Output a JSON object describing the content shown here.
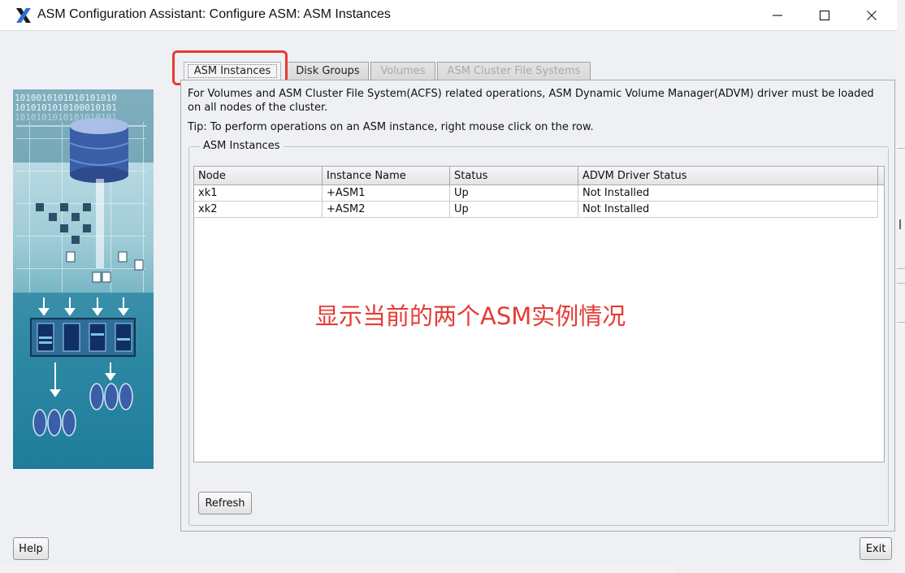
{
  "window": {
    "title": "ASM Configuration Assistant: Configure ASM: ASM Instances",
    "app_icon": "x-logo-icon",
    "controls": [
      "minimize-icon",
      "maximize-icon",
      "close-icon"
    ]
  },
  "sidebar_art": {
    "binary_rows": [
      "1010010101010101010",
      "1010101010100010101",
      "1010101010101010101"
    ]
  },
  "tabs": [
    {
      "label": "ASM Instances",
      "state": "selected"
    },
    {
      "label": "Disk Groups",
      "state": "normal"
    },
    {
      "label": "Volumes",
      "state": "disabled"
    },
    {
      "label": "ASM Cluster File Systems",
      "state": "disabled"
    }
  ],
  "info": {
    "line1": "For Volumes and ASM Cluster File System(ACFS) related operations, ASM Dynamic Volume Manager(ADVM) driver must be loaded",
    "line2": "on all nodes of the cluster.",
    "tip": "Tip: To perform operations on an ASM instance, right mouse click on the row."
  },
  "instances_group": {
    "legend": "ASM Instances",
    "columns": [
      "Node",
      "Instance Name",
      "Status",
      "ADVM Driver Status"
    ],
    "rows": [
      [
        "xk1",
        "+ASM1",
        "Up",
        "Not Installed"
      ],
      [
        "xk2",
        "+ASM2",
        "Up",
        "Not Installed"
      ]
    ]
  },
  "annotation": {
    "text": "显示当前的两个ASM实例情况",
    "color": "#e53b34"
  },
  "buttons": {
    "refresh": "Refresh",
    "help": "Help",
    "exit": "Exit"
  },
  "colors": {
    "callout": "#e53b34",
    "window_bg": "#eef0f4",
    "art_gradient_top": "#cfe7ee",
    "art_gradient_bottom": "#1f7896"
  }
}
